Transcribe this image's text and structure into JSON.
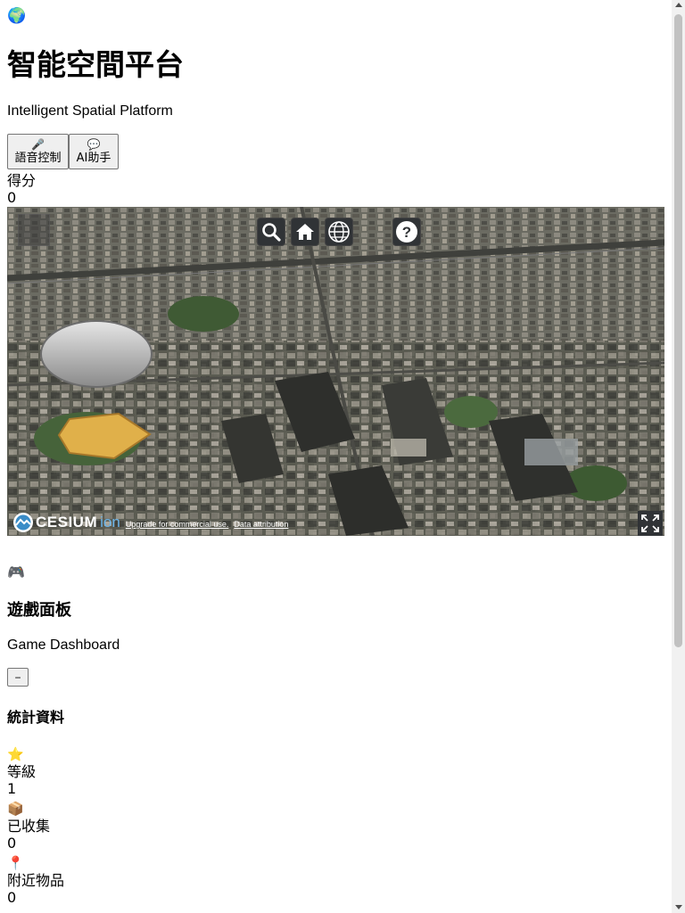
{
  "header": {
    "logo_icon": "globe-emoji",
    "logo_glyph": "🌍",
    "title": "智能空間平台",
    "subtitle": "Intelligent Spatial Platform",
    "voice_button": {
      "icon": "microphone-icon",
      "glyph": "🎤",
      "label": "語音控制"
    },
    "ai_button": {
      "icon": "speech-bubble-icon",
      "glyph": "💬",
      "label": "AI助手"
    },
    "score_label": "得分",
    "score_value": "0"
  },
  "map_viewer": {
    "toolbar": [
      "search-icon",
      "home-icon",
      "globe-icon",
      "base-layer-picker",
      "help-icon"
    ],
    "logo_text": "CESIUM",
    "logo_suffix": "ion",
    "credit_upgrade": "Upgrade for commercial use.",
    "credit_attribution": "Data attribution",
    "fullscreen_icon": "fullscreen-icon"
  },
  "dashboard": {
    "icon": "game-controller-emoji",
    "glyph": "🎮",
    "title": "遊戲面板",
    "subtitle": "Game Dashboard",
    "collapse_label": "−",
    "stats_title": "統計資料",
    "stats": [
      {
        "icon": "star-emoji",
        "glyph": "⭐",
        "label": "等級",
        "value": "1"
      },
      {
        "icon": "package-emoji",
        "glyph": "📦",
        "label": "已收集",
        "value": "0"
      },
      {
        "icon": "pin-emoji",
        "glyph": "📍",
        "label": "附近物品",
        "value": "0"
      }
    ]
  }
}
